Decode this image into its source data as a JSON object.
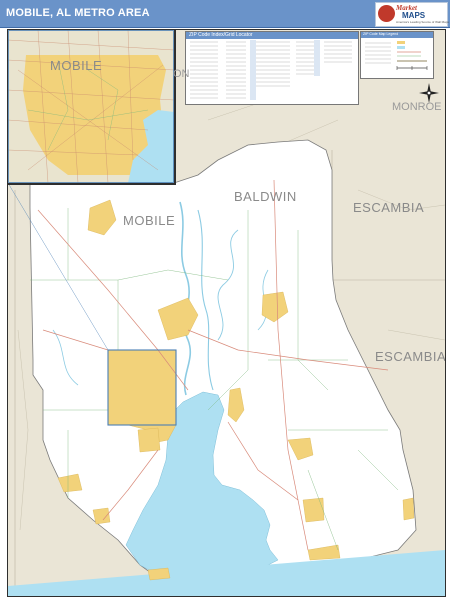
{
  "header": {
    "title": "MOBILE, AL METRO AREA",
    "bar_color": "#6a93c9"
  },
  "logo": {
    "word1": "Market",
    "word2": "MAPS",
    "tagline": "America's Leading Source of Wall Maps"
  },
  "map": {
    "counties": {
      "mobile": "MOBILE",
      "baldwin": "BALDWIN",
      "escambia_upper": "ESCAMBIA",
      "escambia_lower": "ESCAMBIA",
      "monroe_fragment": "MONROE",
      "washington_fragment": "ON"
    },
    "inset_label": "MOBILE",
    "index_title": "ZIP Code Index/Grid Locator",
    "legend_title": "ZIP Code Map Legend",
    "colors": {
      "water": "#aee0f2",
      "land": "#ffffff",
      "outside": "#eae5d6",
      "urban": "#f2d27a",
      "roads": "#d88a7a",
      "zip_boundaries": "#7cb87c",
      "header": "#6a93c9"
    },
    "compass_icon": "north-arrow-icon"
  }
}
